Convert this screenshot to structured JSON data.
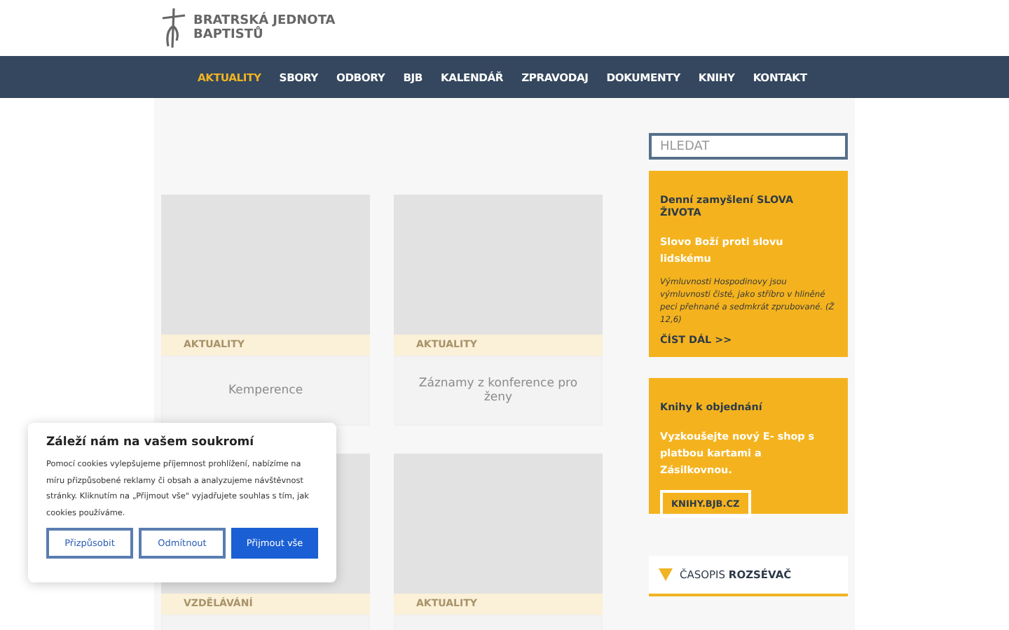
{
  "logo": {
    "line1": "BRATRSKÁ JEDNOTA",
    "line2": "BAPTISTŮ"
  },
  "nav": [
    {
      "label": "AKTUALITY",
      "selected": true
    },
    {
      "label": "SBORY",
      "selected": false
    },
    {
      "label": "ODBORY",
      "selected": false
    },
    {
      "label": "BJB",
      "selected": false
    },
    {
      "label": "KALENDÁŘ",
      "selected": false
    },
    {
      "label": "ZPRAVODAJ",
      "selected": false
    },
    {
      "label": "DOKUMENTY",
      "selected": false
    },
    {
      "label": "KNIHY",
      "selected": false
    },
    {
      "label": "KONTAKT",
      "selected": false
    }
  ],
  "cards": [
    {
      "category": "AKTUALITY",
      "title": "Kemperence"
    },
    {
      "category": "AKTUALITY",
      "title": "Záznamy z konference pro ženy"
    },
    {
      "category": "VZDĚLÁVÁNÍ"
    },
    {
      "category": "AKTUALITY"
    }
  ],
  "search": {
    "placeholder": "HLEDAT"
  },
  "daily": {
    "heading": "Denní zamyšlení SLOVA ŽIVOTA",
    "subtitle": "Slovo Boží proti slovu lidskému",
    "quote": "Výmluvnosti Hospodinovy jsou výmluvnosti čisté, jako stříbro v hliněné peci přehnané a sedmkrát zprubované. (Ž 12,6)",
    "link": "ČÍST DÁL >>"
  },
  "books": {
    "heading": "Knihy k objednání",
    "text": "Vyzkoušejte nový E- shop s platbou kartami a Zásilkovnou.",
    "button": "KNIHY.BJB.CZ"
  },
  "magazine": {
    "label": "ČASOPIS **ROZSÉVAČ**"
  },
  "cookie": {
    "title": "Záleží nám na vašem soukromí",
    "text": "Pomocí cookies vylepšujeme příjemnost prohlížení, nabízíme na míru přizpůsobené reklamy či obsah a analyzujeme návštěvnost stránky. Kliknutím na „Přijmout vše\" vyjadřujete souhlas s tím, jak cookies používáme.",
    "buttons": [
      {
        "label": "Přizpůsobit",
        "kind": "outline"
      },
      {
        "label": "Odmítnout",
        "kind": "outline"
      },
      {
        "label": "Přijmout vše",
        "kind": "primary"
      }
    ]
  }
}
